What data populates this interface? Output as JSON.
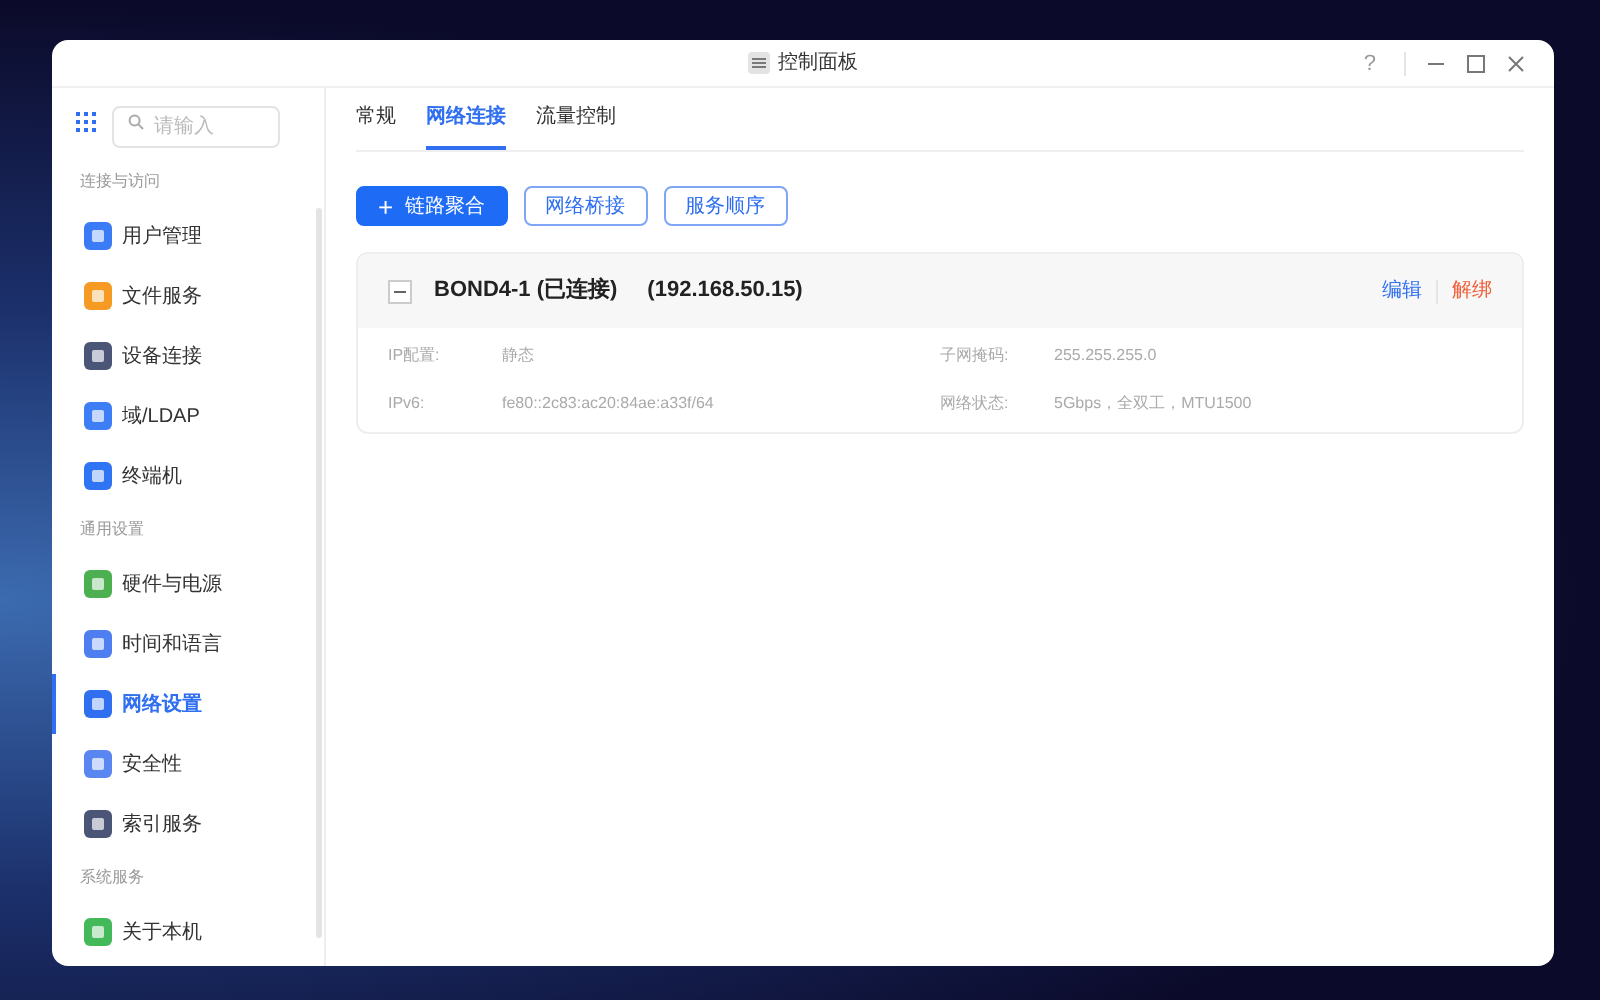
{
  "window": {
    "title": "控制面板",
    "help": "?"
  },
  "search": {
    "placeholder": "请输入"
  },
  "sidebar": {
    "groups": [
      {
        "heading": "连接与访问",
        "items": [
          {
            "label": "用户管理",
            "selected": false,
            "color": "#3b7bf5"
          },
          {
            "label": "文件服务",
            "selected": false,
            "color": "#f59a23"
          },
          {
            "label": "设备连接",
            "selected": false,
            "color": "#4a5578"
          },
          {
            "label": "域/LDAP",
            "selected": false,
            "color": "#3d7df6"
          },
          {
            "label": "终端机",
            "selected": false,
            "color": "#2f74f2"
          }
        ]
      },
      {
        "heading": "通用设置",
        "items": [
          {
            "label": "硬件与电源",
            "selected": false,
            "color": "#4caf50"
          },
          {
            "label": "时间和语言",
            "selected": false,
            "color": "#4f7ef0"
          },
          {
            "label": "网络设置",
            "selected": true,
            "color": "#2f6ff0"
          },
          {
            "label": "安全性",
            "selected": false,
            "color": "#5a86f2"
          },
          {
            "label": "索引服务",
            "selected": false,
            "color": "#4a5578"
          }
        ]
      },
      {
        "heading": "系统服务",
        "items": [
          {
            "label": "关于本机",
            "selected": false,
            "color": "#43b95a"
          }
        ]
      }
    ]
  },
  "tabs": [
    {
      "label": "常规",
      "selected": false
    },
    {
      "label": "网络连接",
      "selected": true
    },
    {
      "label": "流量控制",
      "selected": false
    }
  ],
  "buttons": [
    {
      "label": "链路聚合",
      "kind": "primary",
      "icon": "+"
    },
    {
      "label": "网络桥接",
      "kind": "outline"
    },
    {
      "label": "服务顺序",
      "kind": "outline"
    }
  ],
  "connections": [
    {
      "name": "BOND4-1 (已连接)",
      "ip": "(192.168.50.15)",
      "expanded": true,
      "edit": "编辑",
      "unbind": "解绑",
      "fields": [
        {
          "label": "IP配置:",
          "value": "静态"
        },
        {
          "label": "子网掩码:",
          "value": "255.255.255.0"
        },
        {
          "label": "IPv6:",
          "value": "fe80::2c83:ac20:84ae:a33f/64"
        },
        {
          "label": "网络状态:",
          "value": "5Gbps，全双工，MTU1500"
        }
      ]
    }
  ]
}
